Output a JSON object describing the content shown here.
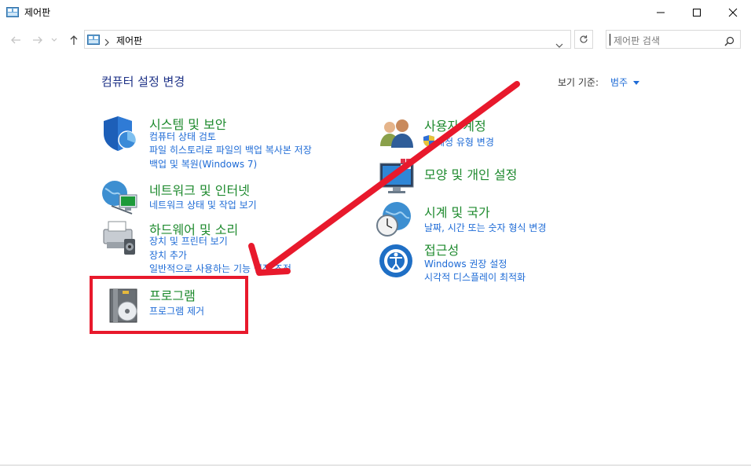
{
  "window": {
    "title": "제어판"
  },
  "address": {
    "crumb": "제어판"
  },
  "search": {
    "placeholder": "제어판 검색"
  },
  "header": {
    "heading": "컴퓨터 설정 변경",
    "view_by_label": "보기 기준:",
    "view_by_value": "범주"
  },
  "categories": {
    "system": {
      "title": "시스템 및 보안",
      "links": [
        "컴퓨터 상태 검토",
        "파일 히스토리로 파일의 백업 복사본 저장",
        "백업 및 복원(Windows 7)"
      ]
    },
    "network": {
      "title": "네트워크 및 인터넷",
      "links": [
        "네트워크 상태 및 작업 보기"
      ]
    },
    "hardware": {
      "title": "하드웨어 및 소리",
      "links": [
        "장치 및 프린터 보기",
        "장치 추가",
        "일반적으로 사용하는 기능 설정 조정"
      ]
    },
    "programs": {
      "title": "프로그램",
      "links": [
        "프로그램 제거"
      ]
    },
    "users": {
      "title": "사용자 계정",
      "links": [
        "계정 유형 변경"
      ]
    },
    "appearance": {
      "title": "모양 및 개인 설정",
      "links": []
    },
    "clock": {
      "title": "시계 및 국가",
      "links": [
        "날짜, 시간 또는 숫자 형식 변경"
      ]
    },
    "ease": {
      "title": "접근성",
      "links": [
        "Windows 권장 설정",
        "시각적 디스플레이 최적화"
      ]
    }
  },
  "colors": {
    "category_title": "#1e8a2e",
    "link": "#1e6bd6",
    "heading": "#1e3287",
    "annotation": "#e8192c"
  }
}
